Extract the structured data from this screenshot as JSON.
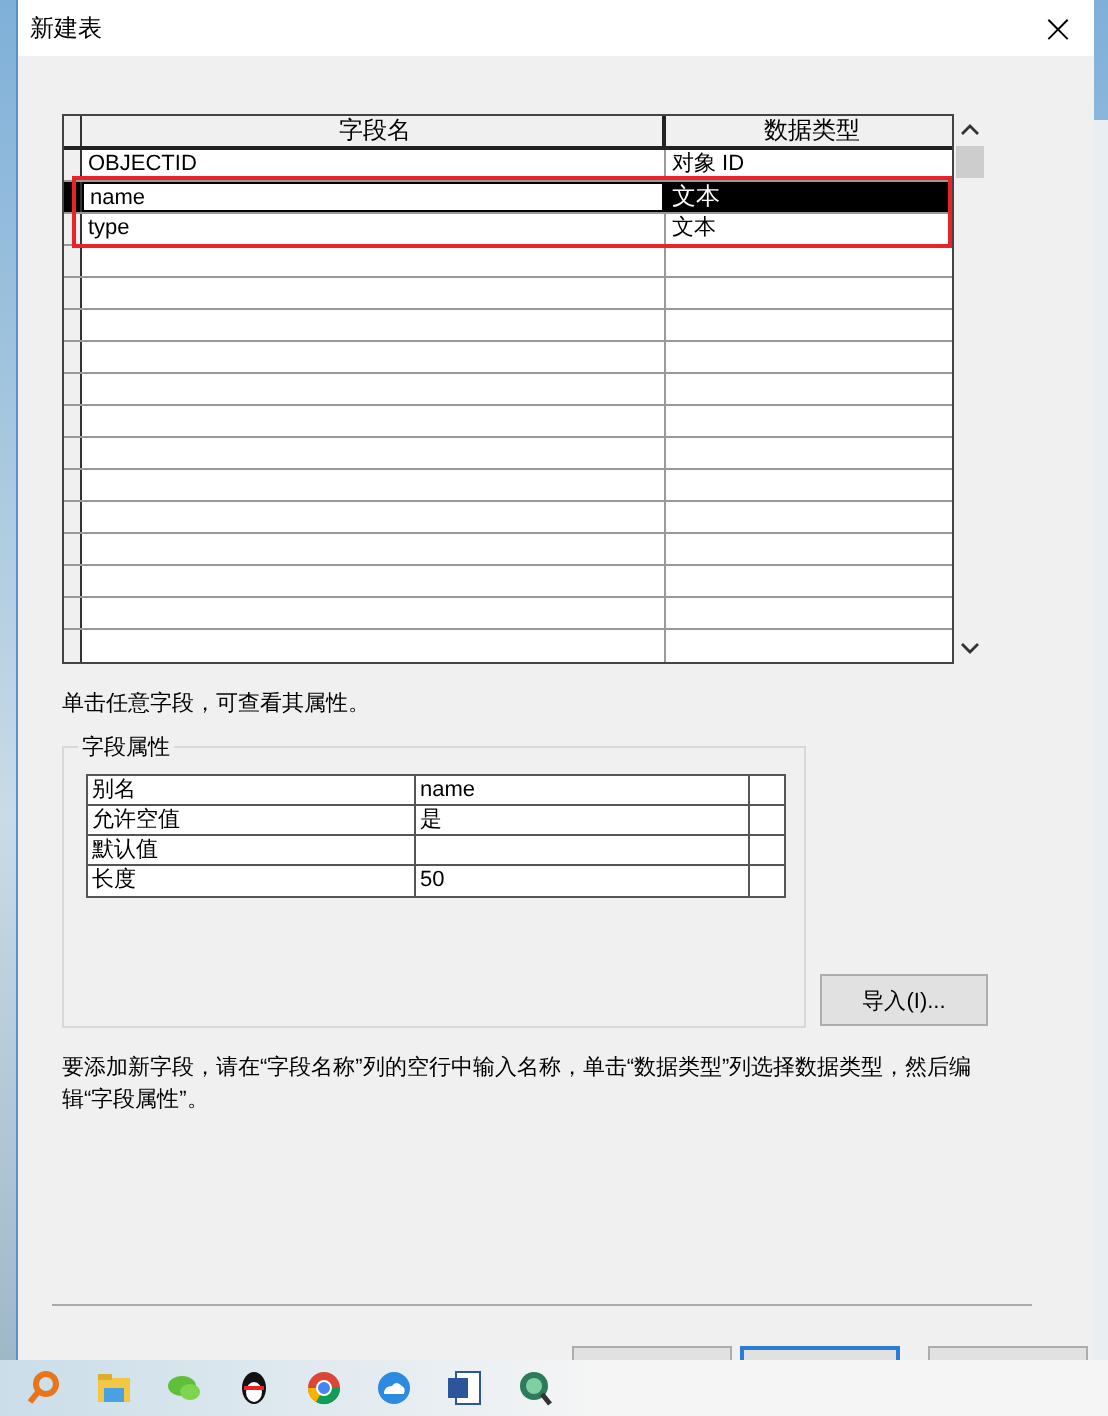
{
  "window": {
    "title": "新建表",
    "close": "×"
  },
  "fields_table": {
    "columns": [
      "字段名",
      "数据类型"
    ],
    "rows": [
      {
        "name": "OBJECTID",
        "type": "对象 ID",
        "selected": false,
        "highlighted": false
      },
      {
        "name": "name",
        "type": "文本",
        "selected": true,
        "highlighted": true
      },
      {
        "name": "type",
        "type": "文本",
        "selected": false,
        "highlighted": true
      }
    ]
  },
  "hint": "单击任意字段，可查看其属性。",
  "field_properties": {
    "title": "字段属性",
    "rows": [
      {
        "label": "别名",
        "value": "name"
      },
      {
        "label": "允许空值",
        "value": "是"
      },
      {
        "label": "默认值"
      },
      {
        "label": "长度",
        "value": "50"
      }
    ]
  },
  "import_button": "导入(I)...",
  "instructions": "要添加新字段，请在“字段名称”列的空行中输入名称，单击“数据类型”列选择数据类型，然后编辑“字段属性”。",
  "footer_buttons": [
    {
      "kind": "normal"
    },
    {
      "kind": "default"
    },
    {
      "kind": "normal"
    }
  ]
}
